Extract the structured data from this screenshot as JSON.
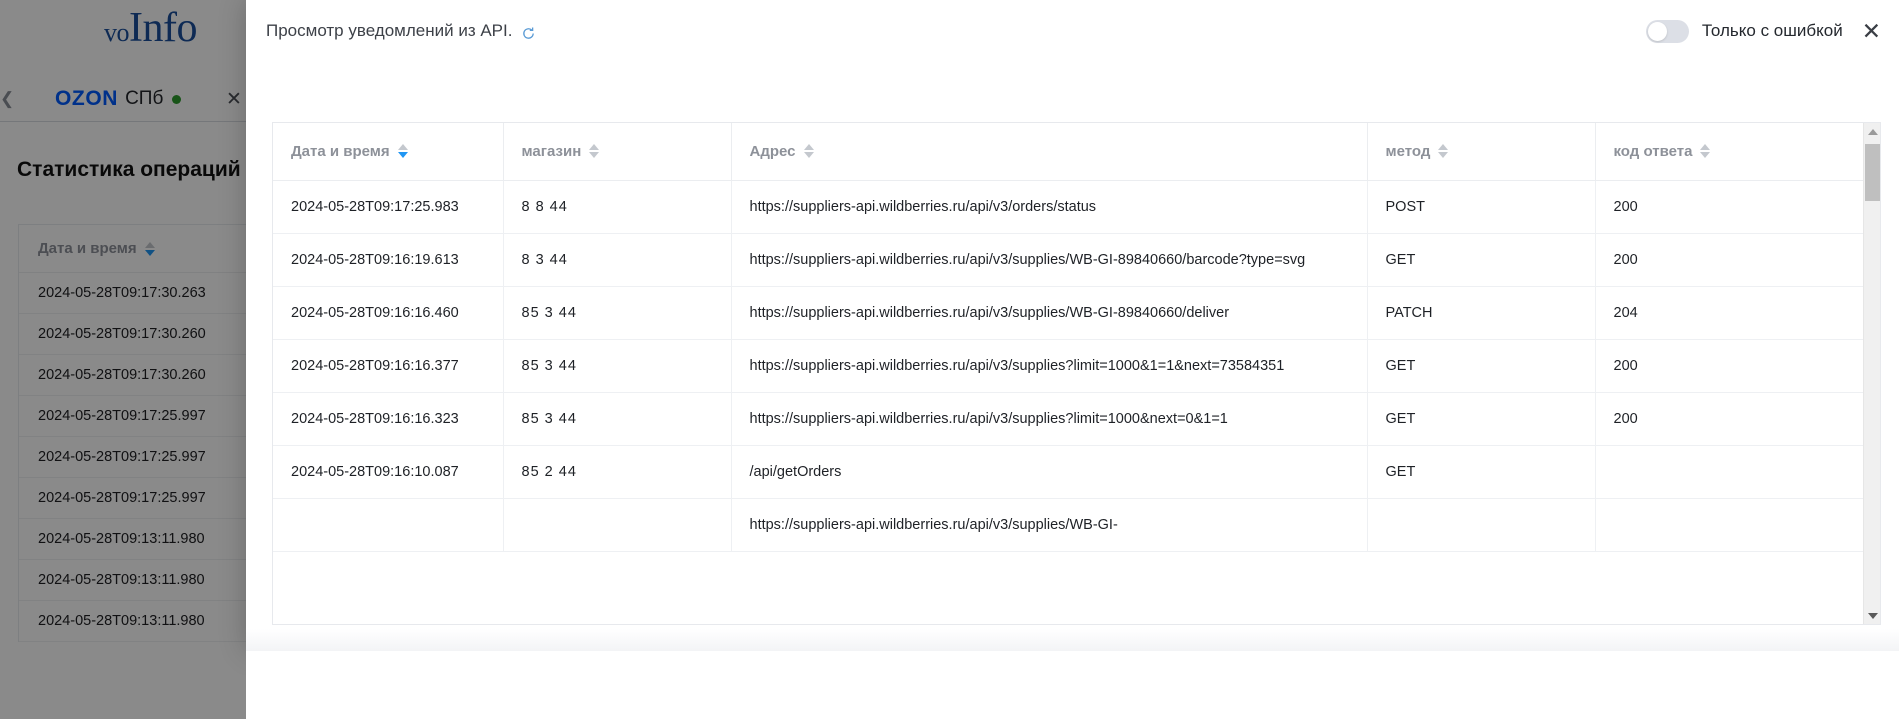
{
  "background": {
    "logo": {
      "prefix": "vo",
      "name": "Info"
    },
    "tab": {
      "brand": "OZON",
      "city": "СПб",
      "status_dot_color": "#2e9b2e",
      "close_icon": "close-icon",
      "back_icon": "chevron-left-icon"
    },
    "heading": "Статистика операций об",
    "table": {
      "header": "Дата и время",
      "rows": [
        "2024-05-28T09:17:30.263",
        "2024-05-28T09:17:30.260",
        "2024-05-28T09:17:30.260",
        "2024-05-28T09:17:25.997",
        "2024-05-28T09:17:25.997",
        "2024-05-28T09:17:25.997",
        "2024-05-28T09:13:11.980",
        "2024-05-28T09:13:11.980",
        "2024-05-28T09:13:11.980"
      ]
    }
  },
  "modal": {
    "title": "Просмотр уведомлений из API.",
    "refresh_icon": "refresh-icon",
    "toggle": {
      "label": "Только с ошибкой",
      "state": "off"
    },
    "close_icon": "close-icon",
    "table": {
      "columns": [
        {
          "key": "date",
          "label": "Дата и время",
          "sorted": "desc"
        },
        {
          "key": "shop",
          "label": "магазин",
          "sorted": "none"
        },
        {
          "key": "url",
          "label": "Адрес",
          "sorted": "none"
        },
        {
          "key": "method",
          "label": "метод",
          "sorted": "none"
        },
        {
          "key": "code",
          "label": "код ответа",
          "sorted": "none"
        }
      ],
      "rows": [
        {
          "date": "2024-05-28T09:17:25.983",
          "shop": "8  8  44",
          "url": "https://suppliers-api.wildberries.ru/api/v3/orders/status",
          "method": "POST",
          "code": "200"
        },
        {
          "date": "2024-05-28T09:16:19.613",
          "shop": "8  3  44",
          "url": "https://suppliers-api.wildberries.ru/api/v3/supplies/WB-GI-89840660/barcode?type=svg",
          "method": "GET",
          "code": "200"
        },
        {
          "date": "2024-05-28T09:16:16.460",
          "shop": "85 3  44",
          "url": "https://suppliers-api.wildberries.ru/api/v3/supplies/WB-GI-89840660/deliver",
          "method": "PATCH",
          "code": "204"
        },
        {
          "date": "2024-05-28T09:16:16.377",
          "shop": "85 3  44",
          "url": "https://suppliers-api.wildberries.ru/api/v3/supplies?limit=1000&1=1&next=73584351",
          "method": "GET",
          "code": "200"
        },
        {
          "date": "2024-05-28T09:16:16.323",
          "shop": "85 3  44",
          "url": "https://suppliers-api.wildberries.ru/api/v3/supplies?limit=1000&next=0&1=1",
          "method": "GET",
          "code": "200"
        },
        {
          "date": "2024-05-28T09:16:10.087",
          "shop": "85 2  44",
          "url": "/api/getOrders",
          "method": "GET",
          "code": ""
        },
        {
          "date": "",
          "shop": "",
          "url": "https://suppliers-api.wildberries.ru/api/v3/supplies/WB-GI-",
          "method": "",
          "code": ""
        }
      ]
    },
    "scrollbar": {
      "up_icon": "scroll-up-arrow-icon",
      "down_icon": "scroll-down-arrow-icon"
    }
  }
}
